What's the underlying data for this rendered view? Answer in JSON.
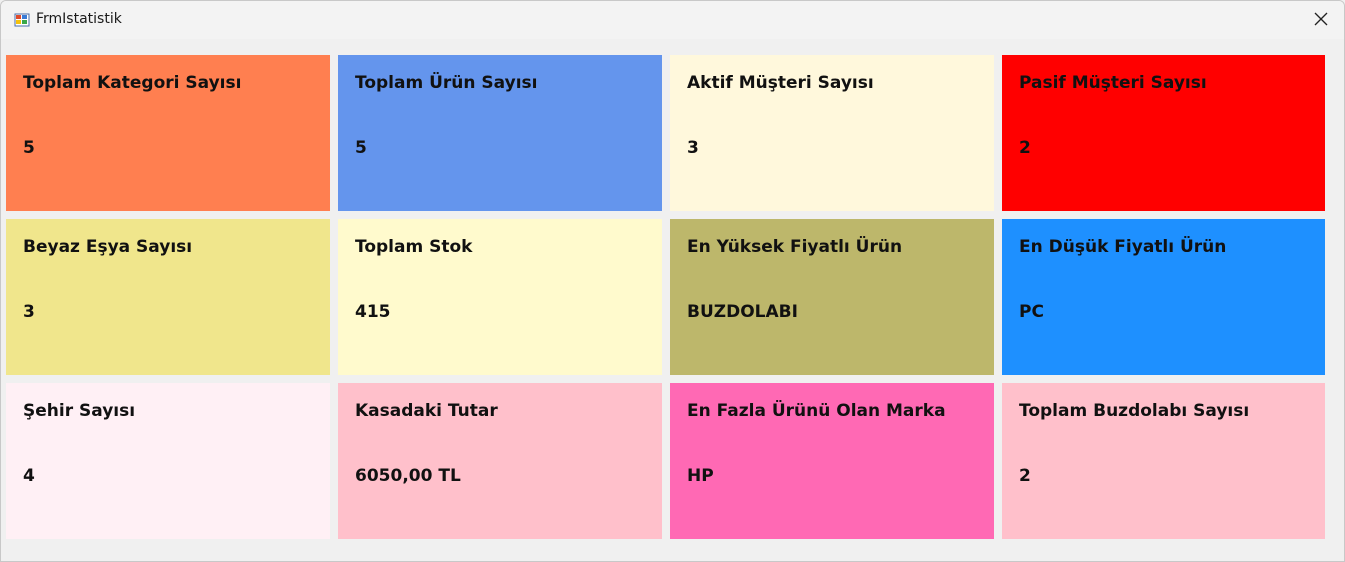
{
  "window": {
    "title": "FrmIstatistik"
  },
  "cards": [
    {
      "label": "Toplam Kategori Sayısı",
      "value": "5",
      "color": "#ff7f50"
    },
    {
      "label": "Toplam Ürün Sayısı",
      "value": "5",
      "color": "#6495ed"
    },
    {
      "label": "Aktif Müşteri Sayısı",
      "value": "3",
      "color": "#fff8dc"
    },
    {
      "label": "Pasif Müşteri Sayısı",
      "value": "2",
      "color": "#ff0000"
    },
    {
      "label": "Beyaz Eşya Sayısı",
      "value": "3",
      "color": "#f0e68c"
    },
    {
      "label": "Toplam Stok",
      "value": "415",
      "color": "#fffacd"
    },
    {
      "label": "En Yüksek Fiyatlı Ürün",
      "value": "BUZDOLABI",
      "color": "#bdb76b"
    },
    {
      "label": "En Düşük Fiyatlı Ürün",
      "value": "PC",
      "color": "#1e90ff"
    },
    {
      "label": "Şehir Sayısı",
      "value": "4",
      "color": "#fff0f5"
    },
    {
      "label": "Kasadaki Tutar",
      "value": "6050,00 TL",
      "color": "#ffc0cb"
    },
    {
      "label": "En Fazla Ürünü Olan Marka",
      "value": "HP",
      "color": "#ff69b4"
    },
    {
      "label": "Toplam Buzdolabı Sayısı",
      "value": "2",
      "color": "#ffc0cb"
    }
  ]
}
